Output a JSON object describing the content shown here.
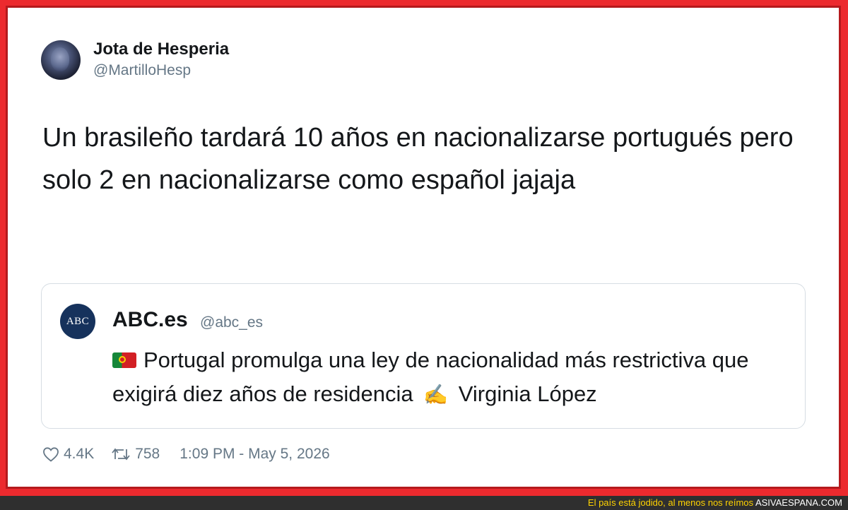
{
  "tweet": {
    "author_name": "Jota de Hesperia",
    "author_handle": "@MartilloHesp",
    "text": "Un brasileño tardará 10 años en nacionalizarse portugués pero solo 2 en nacionalizarse como español jajaja",
    "likes": "4.4K",
    "retweets": "758",
    "timestamp": "1:09 PM - May 5, 2026"
  },
  "quote": {
    "logo_text": "ABC",
    "name": "ABC.es",
    "handle": "@abc_es",
    "text_before": "Portugal promulga una ley de nacionalidad más restrictiva que exigirá diez años de residencia",
    "text_after": "Virginia López",
    "icons": [
      "portugal-flag-icon",
      "writing-hand-icon"
    ]
  },
  "footer": {
    "tagline": "El país está jodido, al menos nos reímos",
    "brand": "ASIVAESPANA.COM"
  },
  "colors": {
    "frame": "#ec2a2e",
    "text": "#14171a",
    "secondary": "#657786",
    "footer_bg": "#2f2f2f",
    "footer_text": "#ffd200"
  }
}
